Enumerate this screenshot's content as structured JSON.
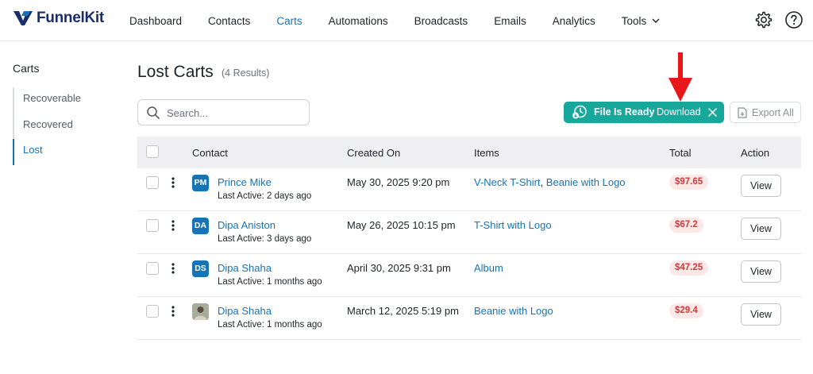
{
  "brand": {
    "name": "FunnelKit",
    "accent": "#1574b6"
  },
  "nav": {
    "items": [
      {
        "label": "Dashboard"
      },
      {
        "label": "Contacts"
      },
      {
        "label": "Carts",
        "active": true
      },
      {
        "label": "Automations"
      },
      {
        "label": "Broadcasts"
      },
      {
        "label": "Emails"
      },
      {
        "label": "Analytics"
      },
      {
        "label": "Tools",
        "dropdown": true
      }
    ],
    "icons": [
      "gear-icon",
      "help-icon"
    ]
  },
  "sidebar": {
    "title": "Carts",
    "items": [
      {
        "label": "Recoverable"
      },
      {
        "label": "Recovered"
      },
      {
        "label": "Lost",
        "active": true
      }
    ]
  },
  "header": {
    "title": "Lost Carts",
    "count": "(4 Results)"
  },
  "search": {
    "placeholder": "Search...",
    "value": ""
  },
  "toast": {
    "message": "File Is Ready",
    "action": "Download",
    "color": "#17a79b"
  },
  "export": {
    "label": "Export All"
  },
  "table": {
    "columns": [
      "Contact",
      "Created On",
      "Items",
      "Total",
      "Action"
    ],
    "rows": [
      {
        "initials": "PM",
        "name": "Prince Mike",
        "last_active": "Last Active: 2 days ago",
        "created": "May 30, 2025 9:20 pm",
        "items": [
          "V-Neck T-Shirt",
          "Beanie with Logo"
        ],
        "total": "$97.65",
        "action": "View"
      },
      {
        "initials": "DA",
        "name": "Dipa Aniston",
        "last_active": "Last Active: 3 days ago",
        "created": "May 26, 2025 10:15 pm",
        "items": [
          "T-Shirt with Logo"
        ],
        "total": "$67.2",
        "action": "View"
      },
      {
        "initials": "DS",
        "name": "Dipa Shaha",
        "last_active": "Last Active: 1 months ago",
        "created": "April 30, 2025 9:31 pm",
        "items": [
          "Album"
        ],
        "total": "$47.25",
        "action": "View"
      },
      {
        "initials": "",
        "avatar_photo": true,
        "name": "Dipa Shaha",
        "last_active": "Last Active: 1 months ago",
        "created": "March 12, 2025 5:19 pm",
        "items": [
          "Beanie with Logo"
        ],
        "total": "$29.4",
        "action": "View"
      }
    ]
  }
}
